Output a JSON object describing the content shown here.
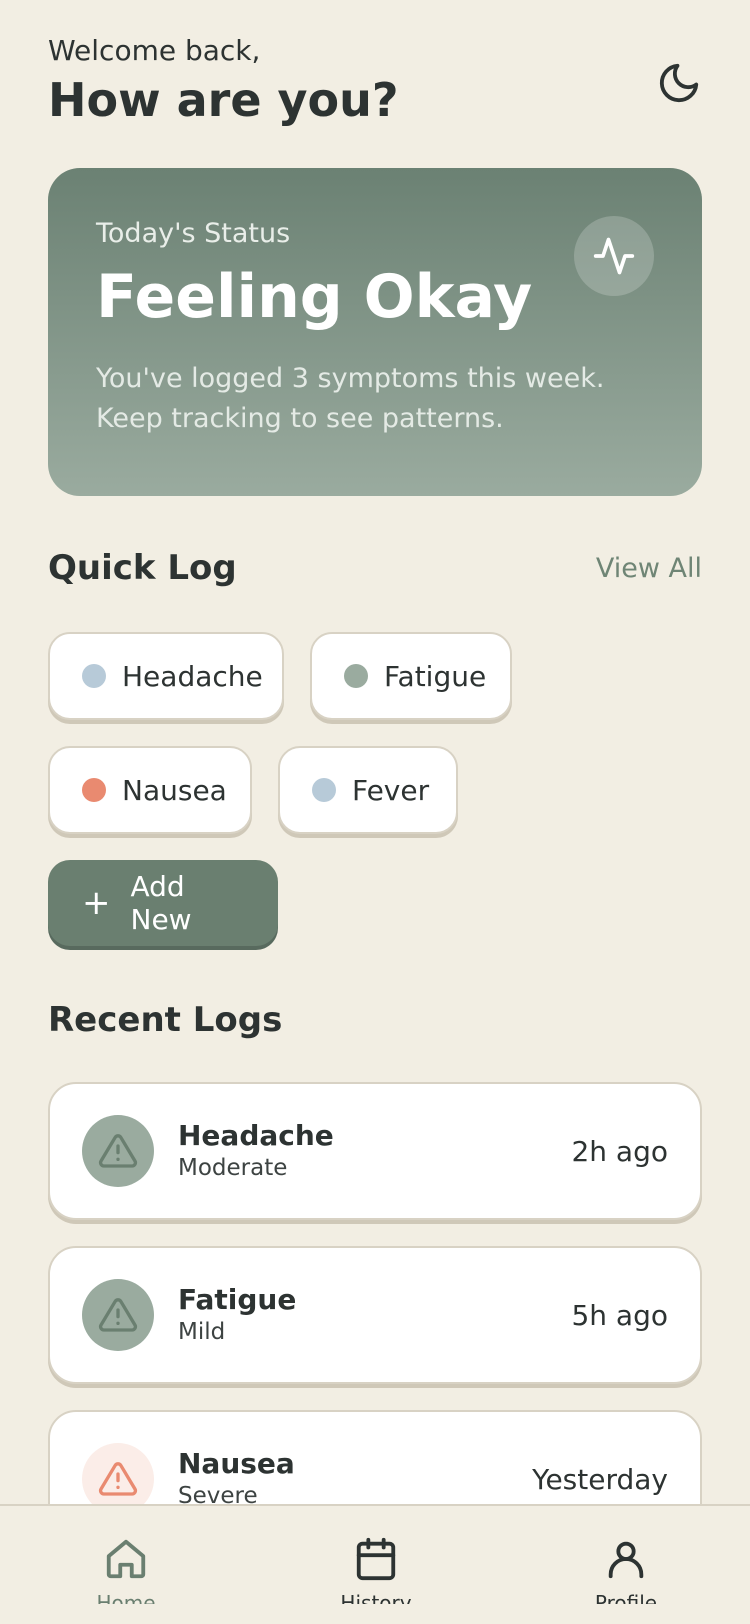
{
  "header": {
    "welcome": "Welcome back,",
    "title": "How are you?",
    "theme_icon": "moon-icon"
  },
  "status": {
    "label": "Today's Status",
    "title": "Feeling Okay",
    "description": "You've logged 3 symptoms this week. Keep tracking to see patterns.",
    "icon": "activity-icon"
  },
  "quick_log": {
    "title": "Quick Log",
    "view_all": "View All",
    "chips": [
      {
        "label": "Headache",
        "color": "#B7CAD8"
      },
      {
        "label": "Fatigue",
        "color": "#9AAB9F"
      },
      {
        "label": "Nausea",
        "color": "#E98A70"
      },
      {
        "label": "Fever",
        "color": "#B7CAD8"
      }
    ],
    "add_label": "Add New"
  },
  "recent_logs": {
    "title": "Recent Logs",
    "items": [
      {
        "name": "Headache",
        "severity": "Moderate",
        "time": "2h ago",
        "icon": "warning-icon",
        "icon_bg": "#9AAB9F",
        "icon_color": "#6A7F70"
      },
      {
        "name": "Fatigue",
        "severity": "Mild",
        "time": "5h ago",
        "icon": "warning-icon",
        "icon_bg": "#9AAB9F",
        "icon_color": "#6A7F70"
      },
      {
        "name": "Nausea",
        "severity": "Severe",
        "time": "Yesterday",
        "icon": "warning-icon",
        "icon_bg": "#FBEDE8",
        "icon_color": "#E98A70"
      }
    ]
  },
  "nav": {
    "items": [
      {
        "label": "Home",
        "icon": "home-icon"
      },
      {
        "label": "History",
        "icon": "calendar-icon"
      },
      {
        "label": "Profile",
        "icon": "user-icon"
      }
    ]
  }
}
